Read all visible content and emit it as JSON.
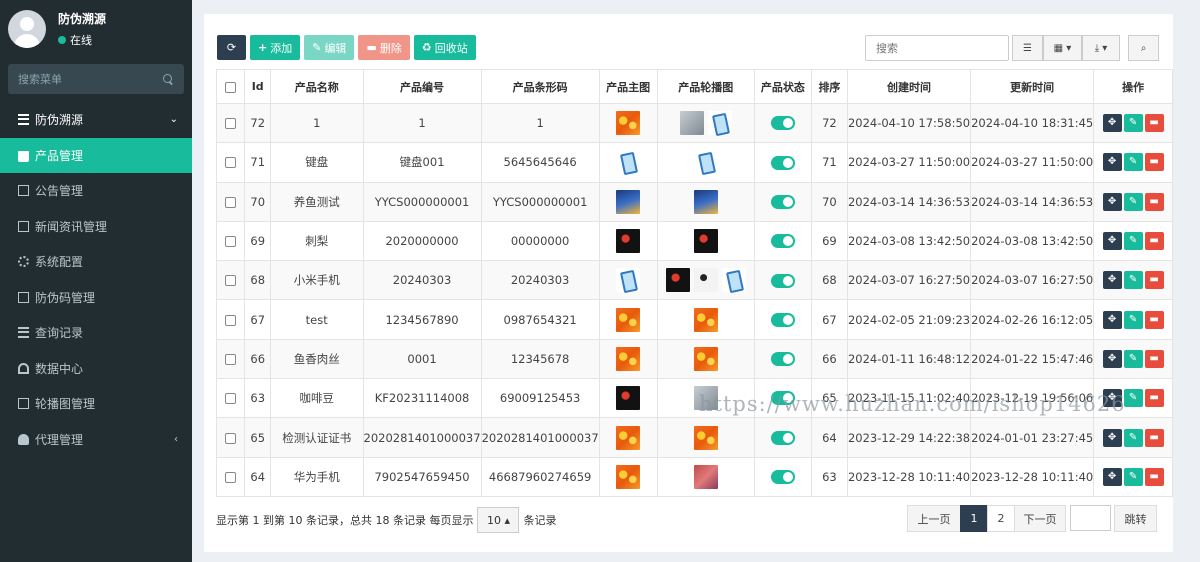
{
  "sidebar": {
    "user_name": "防伪溯源",
    "user_status": "在线",
    "search_placeholder": "搜索菜单",
    "menu": [
      {
        "label": "防伪溯源",
        "icon": "list-icon",
        "arrow": "⌄"
      },
      {
        "label": "产品管理",
        "icon": "shopping-bag-icon"
      },
      {
        "label": "公告管理",
        "icon": "file-icon"
      },
      {
        "label": "新闻资讯管理",
        "icon": "card-icon"
      },
      {
        "label": "系统配置",
        "icon": "gear-icon"
      },
      {
        "label": "防伪码管理",
        "icon": "card-icon"
      },
      {
        "label": "查询记录",
        "icon": "list-icon"
      },
      {
        "label": "数据中心",
        "icon": "dashboard-icon"
      },
      {
        "label": "轮播图管理",
        "icon": "card-icon"
      },
      {
        "label": "代理管理",
        "icon": "users-icon",
        "arrow": "‹"
      }
    ]
  },
  "toolbar": {
    "refresh_glyph": "⟳",
    "add_label": "添加",
    "edit_label": "编辑",
    "delete_label": "删除",
    "recycle_label": "回收站",
    "search_placeholder": "搜索",
    "search_glyph": "⌕"
  },
  "table": {
    "headers": [
      "Id",
      "产品名称",
      "产品编号",
      "产品条形码",
      "产品主图",
      "产品轮播图",
      "产品状态",
      "排序",
      "创建时间",
      "更新时间",
      "操作"
    ],
    "rows": [
      {
        "id": "72",
        "name": "1",
        "code": "1",
        "barcode": "1",
        "main": "flower",
        "carousel": [
          "gray",
          "phone"
        ],
        "sort": "72",
        "created": "2024-04-10 17:58:50",
        "updated": "2024-04-10 18:31:45"
      },
      {
        "id": "71",
        "name": "键盘",
        "code": "键盘001",
        "barcode": "5645645646",
        "main": "phone",
        "carousel": [
          "phone"
        ],
        "sort": "71",
        "created": "2024-03-27 11:50:00",
        "updated": "2024-03-27 11:50:00"
      },
      {
        "id": "70",
        "name": "养鱼测试",
        "code": "YYCS000000001",
        "barcode": "YYCS000000001",
        "main": "game",
        "carousel": [
          "game"
        ],
        "sort": "70",
        "created": "2024-03-14 14:36:53",
        "updated": "2024-03-14 14:36:53"
      },
      {
        "id": "69",
        "name": "刺梨",
        "code": "2020000000",
        "barcode": "00000000",
        "main": "dark",
        "carousel": [
          "dark"
        ],
        "sort": "69",
        "created": "2024-03-08 13:42:50",
        "updated": "2024-03-08 13:42:50"
      },
      {
        "id": "68",
        "name": "小米手机",
        "code": "20240303",
        "barcode": "20240303",
        "main": "phone",
        "carousel": [
          "dark",
          "white",
          "phone"
        ],
        "sort": "68",
        "created": "2024-03-07 16:27:50",
        "updated": "2024-03-07 16:27:50"
      },
      {
        "id": "67",
        "name": "test",
        "code": "1234567890",
        "barcode": "0987654321",
        "main": "flower",
        "carousel": [
          "flower"
        ],
        "sort": "67",
        "created": "2024-02-05 21:09:23",
        "updated": "2024-02-26 16:12:05"
      },
      {
        "id": "66",
        "name": "鱼香肉丝",
        "code": "0001",
        "barcode": "12345678",
        "main": "flower",
        "carousel": [
          "flower"
        ],
        "sort": "66",
        "created": "2024-01-11 16:48:12",
        "updated": "2024-01-22 15:47:46"
      },
      {
        "id": "63",
        "name": "咖啡豆",
        "code": "KF20231114008",
        "barcode": "69009125453",
        "main": "dark",
        "carousel": [
          "gray"
        ],
        "sort": "65",
        "created": "2023-11-15 11:02:40",
        "updated": "2023-12-19 19:56:06"
      },
      {
        "id": "65",
        "name": "检测认证证书",
        "code": "2020281401000037",
        "barcode": "2020281401000037",
        "main": "flower",
        "carousel": [
          "flower"
        ],
        "sort": "64",
        "created": "2023-12-29 14:22:38",
        "updated": "2024-01-01 23:27:45"
      },
      {
        "id": "64",
        "name": "华为手机",
        "code": "7902547659450",
        "barcode": "46687960274659",
        "main": "flower",
        "carousel": [
          "red"
        ],
        "sort": "63",
        "created": "2023-12-28 10:11:40",
        "updated": "2023-12-28 10:11:40"
      }
    ]
  },
  "footer": {
    "info_before": "显示第 1 到第 10 条记录，总共 18 条记录 每页显示",
    "page_size": "10",
    "info_after": "条记录",
    "prev": "上一页",
    "page1": "1",
    "page2": "2",
    "next": "下一页",
    "jump": "跳转"
  },
  "watermark": "https://www.huzhan.com/ishop14626",
  "colors": {
    "sidebar_bg": "#222d32",
    "accent": "#18bc9c",
    "primary_dark": "#2c3e50",
    "danger": "#e74c3c"
  }
}
